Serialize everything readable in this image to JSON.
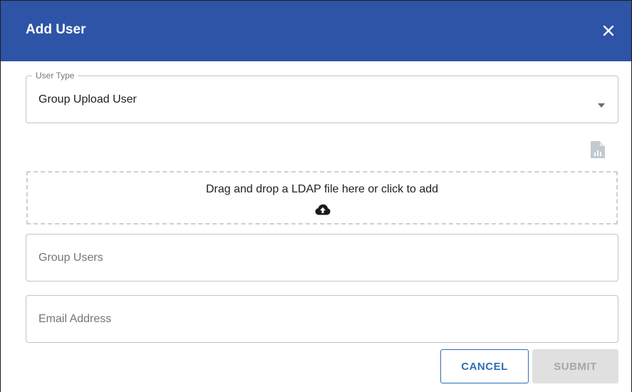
{
  "dialog": {
    "title": "Add User",
    "close_icon": "close-icon"
  },
  "user_type": {
    "label": "User Type",
    "value": "Group Upload User",
    "dropdown_icon": "caret-down-icon"
  },
  "file_icon": "file-chart-icon",
  "dropzone": {
    "text": "Drag and drop a LDAP file here or click to add",
    "icon": "cloud-upload-icon"
  },
  "group_users": {
    "placeholder": "Group Users",
    "value": ""
  },
  "email": {
    "placeholder": "Email Address",
    "value": ""
  },
  "actions": {
    "cancel_label": "CANCEL",
    "submit_label": "SUBMIT"
  },
  "colors": {
    "header": "#2d54a6",
    "primary": "#2d6fb8",
    "disabled_bg": "#e0e0e0",
    "disabled_text": "#a6a6a6"
  }
}
